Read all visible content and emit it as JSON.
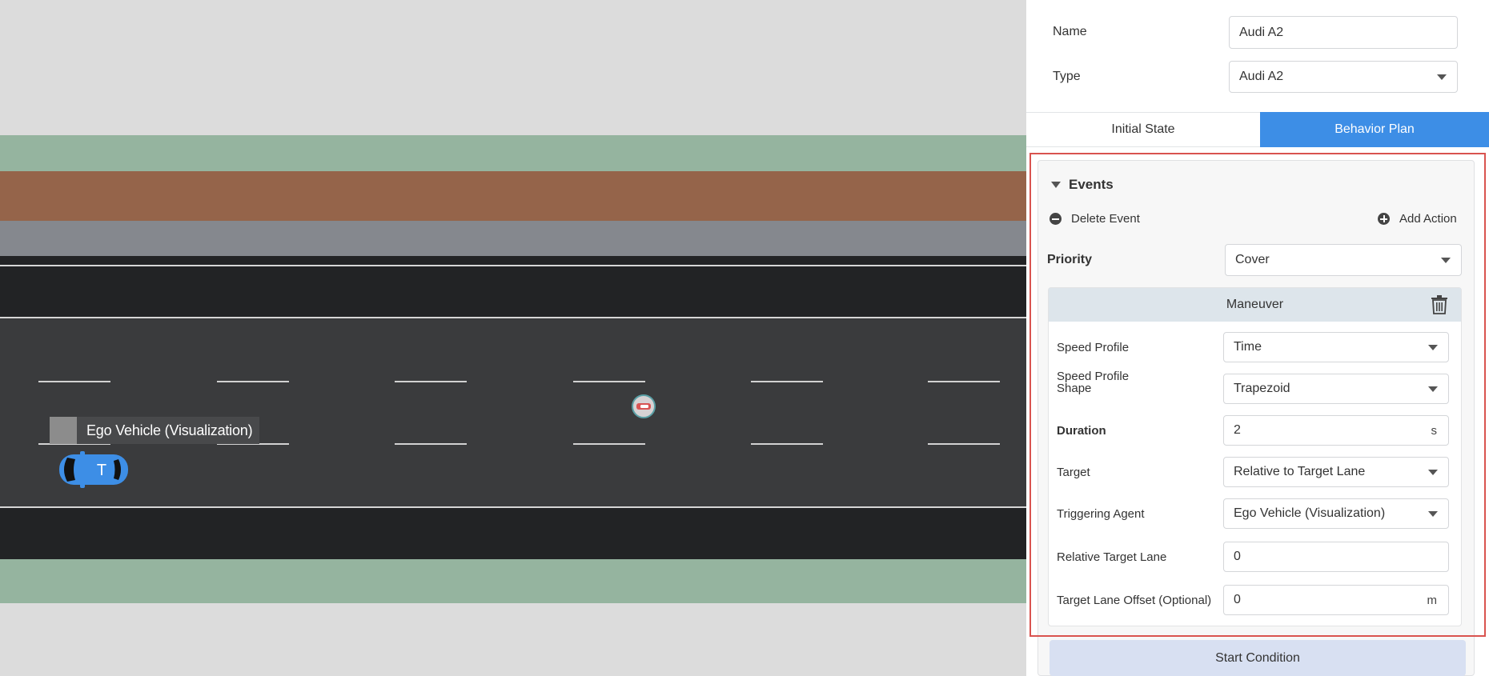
{
  "viewport": {
    "ego_label": "Ego Vehicle (Visualization)",
    "ego_car_letter": "T"
  },
  "panel": {
    "name_label": "Name",
    "name_value": "Audi A2",
    "type_label": "Type",
    "type_value": "Audi A2",
    "tabs": [
      {
        "label": "Initial State",
        "active": false
      },
      {
        "label": "Behavior Plan",
        "active": true
      }
    ],
    "events": {
      "title": "Events",
      "delete_event": "Delete Event",
      "add_action": "Add Action",
      "priority_label": "Priority",
      "priority_value": "Cover"
    },
    "maneuver": {
      "title": "Maneuver",
      "speed_profile_label": "Speed Profile",
      "speed_profile_value": "Time",
      "speed_profile_shape_label_1": "Speed Profile",
      "speed_profile_shape_label_2": "Shape",
      "speed_profile_shape_value": "Trapezoid",
      "duration_label": "Duration",
      "duration_value": "2",
      "duration_unit": "s",
      "target_label": "Target",
      "target_value": "Relative to Target Lane",
      "triggering_agent_label": "Triggering Agent",
      "triggering_agent_value": "Ego Vehicle (Visualization)",
      "relative_target_lane_label": "Relative Target Lane",
      "relative_target_lane_value": "0",
      "target_lane_offset_label": "Target Lane Offset (Optional)",
      "target_lane_offset_value": "0",
      "target_lane_offset_unit": "m"
    },
    "start_condition": "Start Condition"
  },
  "colors": {
    "accent": "#3d8ee6",
    "highlight": "#d9534f",
    "grass": "#95b49f",
    "dirt": "#95644a",
    "asphalt": "#3a3b3d",
    "ego_car": "#3d8ee6"
  }
}
